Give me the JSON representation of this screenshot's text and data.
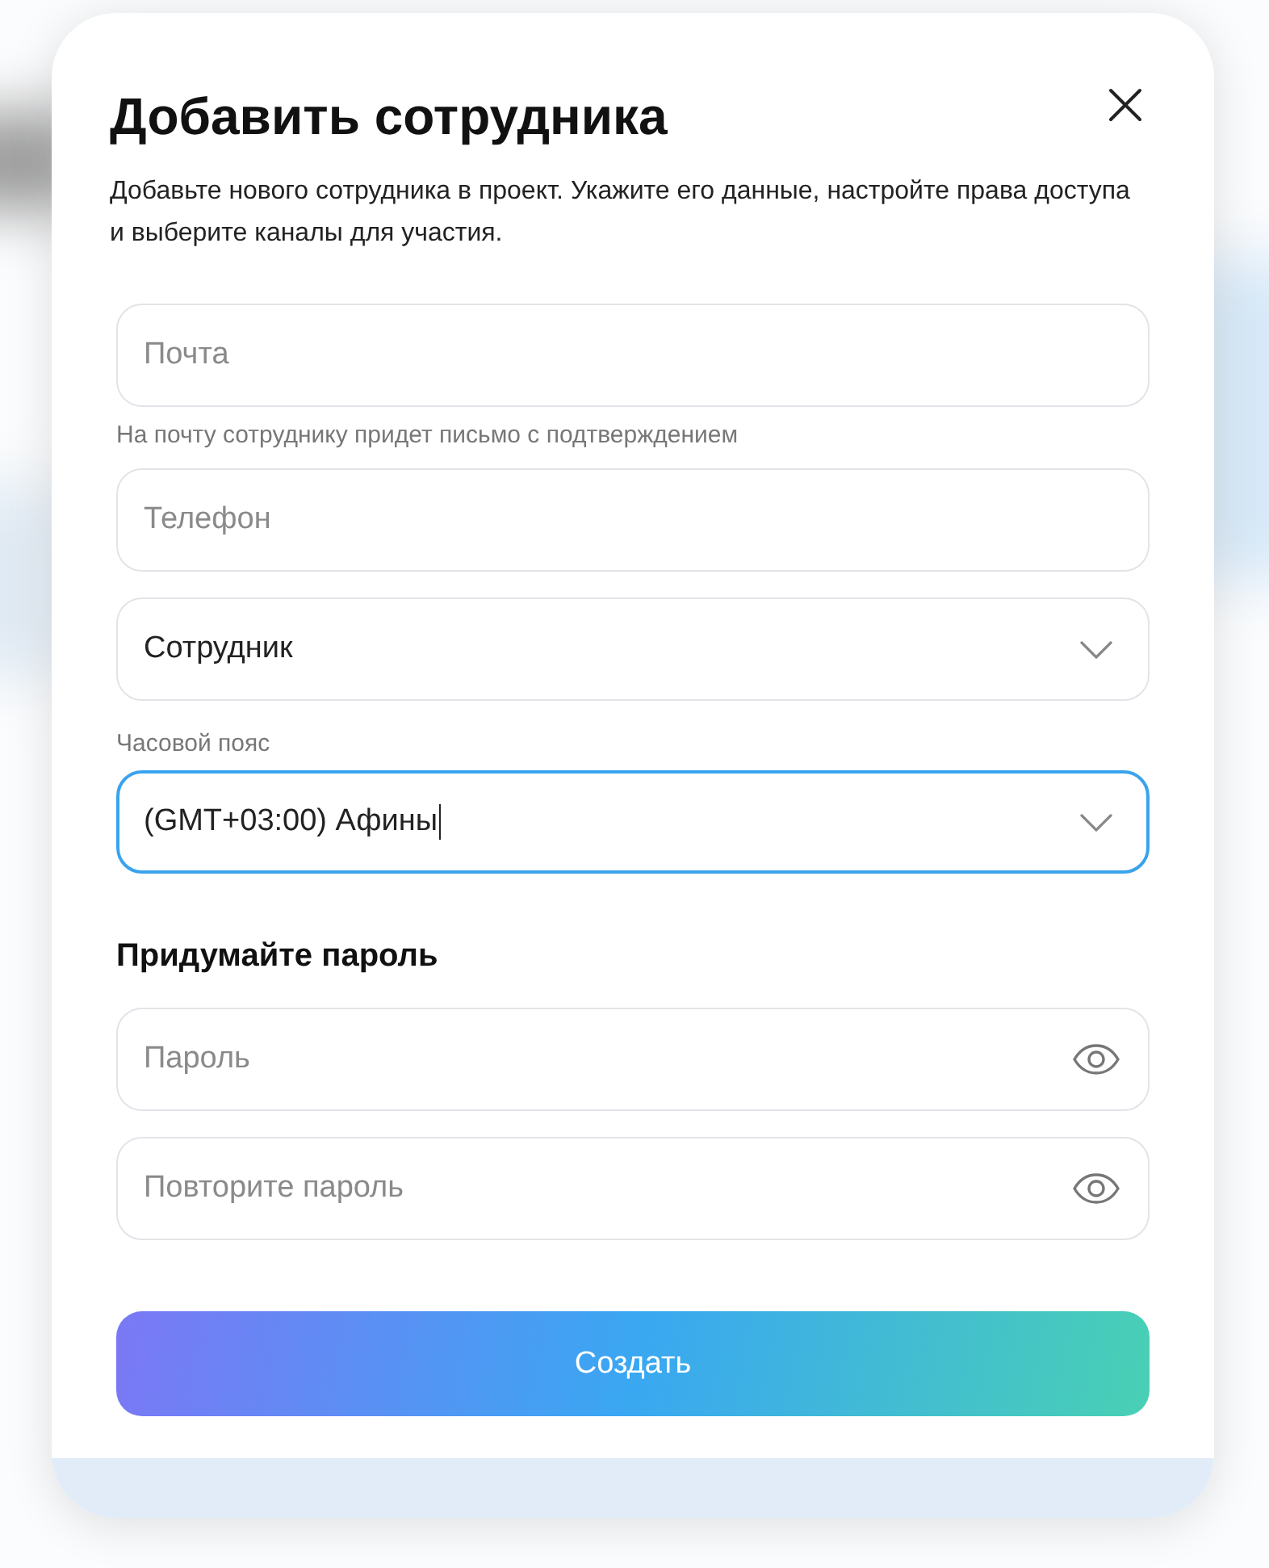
{
  "dialog": {
    "title": "Добавить сотрудника",
    "description": "Добавьте нового сотрудника в проект. Укажите его данные, настройте права доступа и выберите каналы для участия."
  },
  "fields": [
    {
      "kind": "text",
      "placeholder": "Почта",
      "hint": "На почту сотруднику придет письмо с подтверждением",
      "focused": false
    },
    {
      "kind": "text",
      "placeholder": "Телефон",
      "focused": false
    },
    {
      "kind": "select",
      "value": "Сотрудник",
      "focused": false
    },
    {
      "kind": "select",
      "label": "Часовой пояс",
      "value": "(GMT+03:00) Афины",
      "focused": true
    }
  ],
  "password_section": {
    "heading": "Придумайте пароль",
    "fields": [
      {
        "placeholder": "Пароль",
        "focused": false
      },
      {
        "placeholder": "Повторите пароль",
        "focused": false
      }
    ]
  },
  "submit_button": "Создать"
}
